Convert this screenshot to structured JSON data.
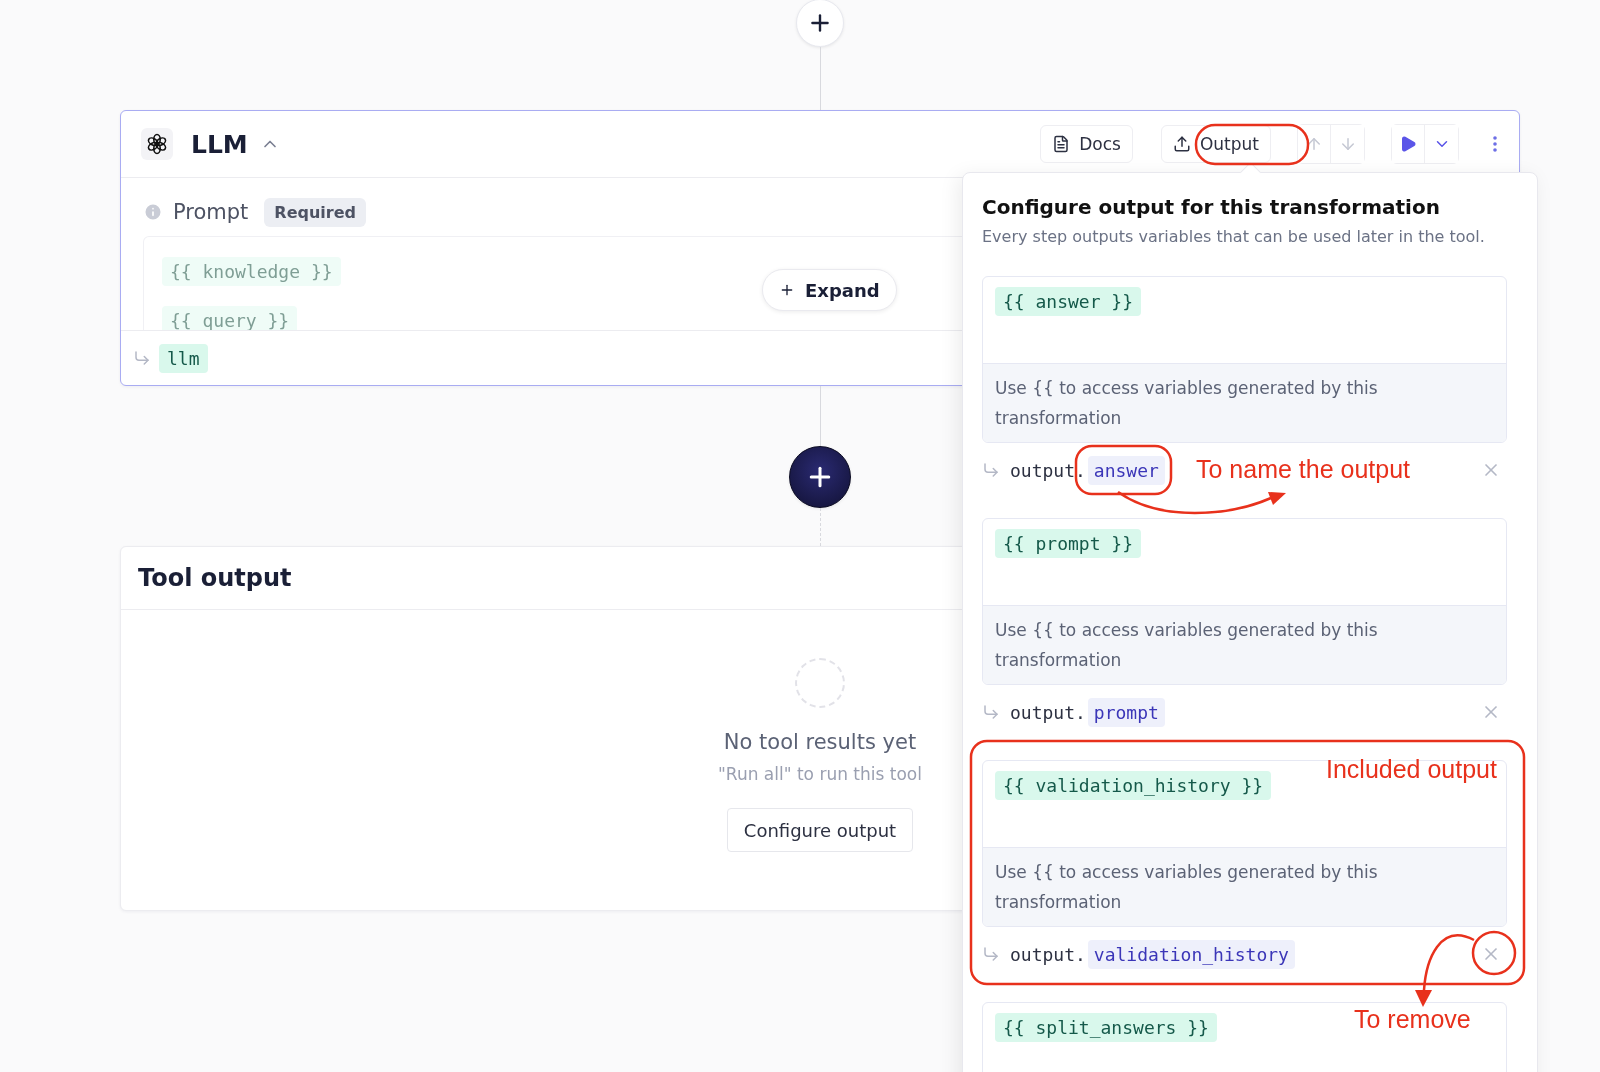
{
  "llm_step": {
    "title": "LLM",
    "expanded": true,
    "toolbar": [
      {
        "kind": "docs",
        "label": "Docs"
      },
      {
        "kind": "output",
        "label": "Output"
      }
    ],
    "prompt": {
      "label": "Prompt",
      "badge": "Required",
      "variables": [
        "{{ knowledge }}",
        "{{ query }}"
      ],
      "expand_label": "Expand"
    },
    "output_variable": "llm"
  },
  "tool_output": {
    "title": "Tool output",
    "empty_title": "No tool results yet",
    "empty_hint": "\"Run all\" to run this tool",
    "button": "Configure output"
  },
  "output_popover": {
    "title": "Configure output for this transformation",
    "subtitle": "Every step outputs variables that can be used later in the tool.",
    "outputs": [
      {
        "variable": "{{ answer }}",
        "hint": "Use {{ to access variables generated by this transformation",
        "prefix": "output.",
        "name": "answer"
      },
      {
        "variable": "{{ prompt }}",
        "hint": "Use {{ to access variables generated by this transformation",
        "prefix": "output.",
        "name": "prompt"
      },
      {
        "variable": "{{ validation_history }}",
        "hint": "Use {{ to access variables generated by this transformation",
        "prefix": "output.",
        "name": "validation_history"
      },
      {
        "variable": "{{ split_answers }}"
      }
    ]
  },
  "annotations": [
    {
      "kind": "name",
      "text": "To name the output"
    },
    {
      "kind": "included",
      "text": "Included output"
    },
    {
      "kind": "remove",
      "text": "To remove"
    }
  ]
}
